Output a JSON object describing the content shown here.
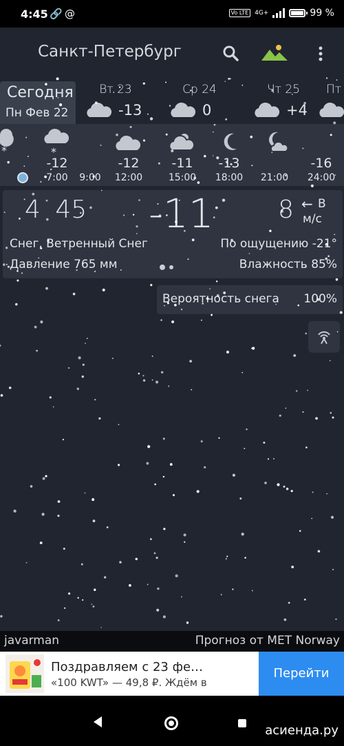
{
  "status_bar": {
    "time": "4:45",
    "icons": [
      "link-icon",
      "at-icon"
    ],
    "volte": "Vo LTE",
    "network": "4G+",
    "battery": "99 %"
  },
  "app_bar": {
    "city": "Санкт-Петербург",
    "icons": [
      "search-icon",
      "landscape-icon",
      "more-vert-icon"
    ],
    "landscape_color": "#8bc34a"
  },
  "daily": {
    "today_label": "Сегодня",
    "today_date": "Пн Фев 22",
    "days": [
      {
        "name": "Вт 23",
        "icon": "cloud-icon",
        "temp": "-13"
      },
      {
        "name": "Ср 24",
        "icon": "cloud-icon",
        "temp": "0"
      },
      {
        "name": "Чт 25",
        "icon": "cloud-icon",
        "temp": "+4"
      },
      {
        "name": "Пт",
        "icon": "cloud-icon",
        "temp": ""
      }
    ]
  },
  "hourly": [
    {
      "icon": "snow-cloud-icon",
      "temp": "-12",
      "time": "7:00"
    },
    {
      "icon": "snow-cloud-icon",
      "temp": "",
      "time": "9:00"
    },
    {
      "icon": "cloud-icon",
      "temp": "-12",
      "time": "12:00"
    },
    {
      "icon": "sun-cloud-icon",
      "temp": "-11",
      "time": "15:00"
    },
    {
      "icon": "moon-icon",
      "temp": "-13",
      "time": "18:00"
    },
    {
      "icon": "moon-cloud-icon",
      "temp": "",
      "time": "21:00"
    },
    {
      "icon": "",
      "temp": "-16",
      "time": "24:00"
    }
  ],
  "current": {
    "time": "4 45",
    "temperature": "-11",
    "wind_speed": "8",
    "wind_dir": "В",
    "wind_unit": "м/с",
    "condition": "Снег, Ветренный Снег",
    "feels_like": "По ощущению -21°",
    "pressure": "Давление 765 мм",
    "humidity": "Влажность 85%"
  },
  "precip": {
    "label": "Вероятность снега",
    "value": "100%"
  },
  "footer": {
    "author": "javarman",
    "provider": "Прогноз от MET Norway"
  },
  "ad": {
    "title": "Поздравляем с 23 фе…",
    "text": "«100 KWT» — 49,8 ₽. Ждём в",
    "button": "Перейти",
    "button_color": "#2d8cf0"
  },
  "nav": {
    "watermark": "асиенда.ру"
  }
}
